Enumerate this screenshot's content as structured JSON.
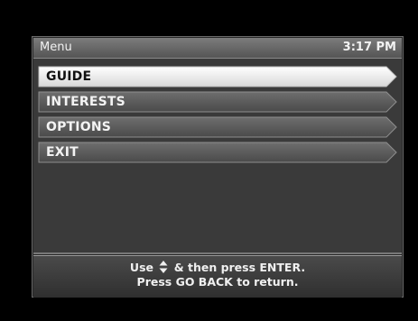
{
  "window": {
    "title": "Menu",
    "clock": "3:17 PM"
  },
  "menu": {
    "items": [
      {
        "label": "GUIDE",
        "selected": true
      },
      {
        "label": "INTERESTS",
        "selected": false
      },
      {
        "label": "OPTIONS",
        "selected": false
      },
      {
        "label": "EXIT",
        "selected": false
      }
    ]
  },
  "footer": {
    "line1_prefix": "Use",
    "line1_suffix": "& then press ENTER.",
    "line2": "Press GO BACK to return.",
    "icon": "up-down-arrows-icon"
  },
  "colors": {
    "selected_fill": "#f2f2f2",
    "item_fill": "#5c5c5c",
    "background": "#000000"
  }
}
